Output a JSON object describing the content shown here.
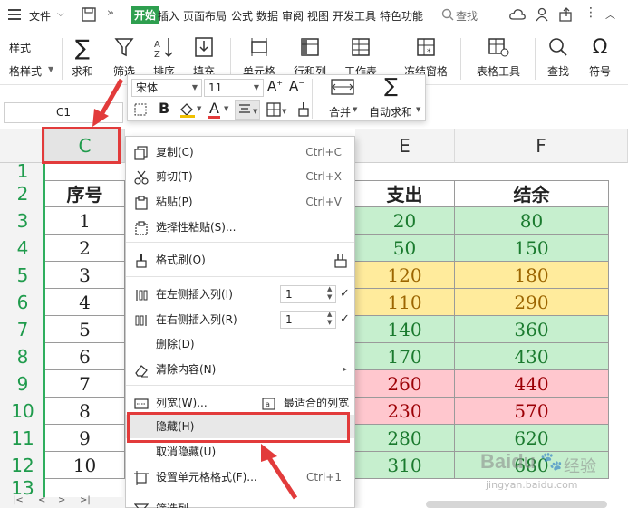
{
  "menubar": {
    "file": "文件",
    "tabs": [
      "开始",
      "插入",
      "页面布局",
      "公式",
      "数据",
      "审阅",
      "视图",
      "开发工具",
      "特色功能"
    ],
    "search": "查找"
  },
  "ribbon": {
    "left_partial": [
      "样式",
      "格样式"
    ],
    "sum": "求和",
    "filter": "筛选",
    "sort": "排序",
    "fill": "填充",
    "cells": "单元格",
    "rowcol": "行和列",
    "sheet": "工作表",
    "freeze": "冻结窗格",
    "table_tools": "表格工具",
    "find": "查找",
    "symbol": "符号"
  },
  "mini_toolbar": {
    "font": "宋体",
    "size": "11",
    "merge": "合并",
    "autosum": "自动求和"
  },
  "namebox": "C1",
  "columns": {
    "C": "C",
    "E": "E",
    "F": "F"
  },
  "rows": [
    "1",
    "2",
    "3",
    "4",
    "5",
    "6",
    "7",
    "8",
    "9",
    "10",
    "11",
    "12",
    "13"
  ],
  "table": {
    "headers": {
      "c": "序号",
      "e": "支出",
      "f": "结余"
    },
    "seq": [
      "1",
      "2",
      "3",
      "4",
      "5",
      "6",
      "7",
      "8",
      "9",
      "10"
    ],
    "expense": [
      "20",
      "50",
      "120",
      "110",
      "140",
      "170",
      "260",
      "230",
      "280",
      "310"
    ],
    "balance": [
      "80",
      "150",
      "180",
      "290",
      "360",
      "430",
      "440",
      "570",
      "620",
      "680"
    ],
    "row_fills": [
      "#c6efce",
      "#c6efce",
      "#ffeb9c",
      "#ffeb9c",
      "#c6efce",
      "#c6efce",
      "#ffc7ce",
      "#ffc7ce",
      "#c6efce",
      "#c6efce"
    ],
    "row_text": [
      "#1a7a2e",
      "#1a7a2e",
      "#9c6500",
      "#9c6500",
      "#1a7a2e",
      "#1a7a2e",
      "#9c0006",
      "#9c0006",
      "#1a7a2e",
      "#1a7a2e"
    ]
  },
  "context_menu": {
    "copy": "复制(C)",
    "copy_key": "Ctrl+C",
    "cut": "剪切(T)",
    "cut_key": "Ctrl+X",
    "paste": "粘贴(P)",
    "paste_key": "Ctrl+V",
    "paste_special": "选择性粘贴(S)...",
    "format_painter": "格式刷(O)",
    "insert_left": "在左侧插入列(I)",
    "insert_left_val": "1",
    "insert_right": "在右侧插入列(R)",
    "insert_right_val": "1",
    "delete": "删除(D)",
    "clear": "清除内容(N)",
    "col_width": "列宽(W)...",
    "best_fit": "最适合的列宽",
    "hide": "隐藏(H)",
    "unhide": "取消隐藏(U)",
    "format_cells": "设置单元格格式(F)...",
    "format_cells_key": "Ctrl+1",
    "filter_partial": "筛选列"
  },
  "watermark": {
    "brand": "Baidu",
    "cn": "经验",
    "url": "jingyan.baidu.com"
  },
  "colors": {
    "accent": "#2e9f4f",
    "annotation_red": "#e23b3b"
  }
}
